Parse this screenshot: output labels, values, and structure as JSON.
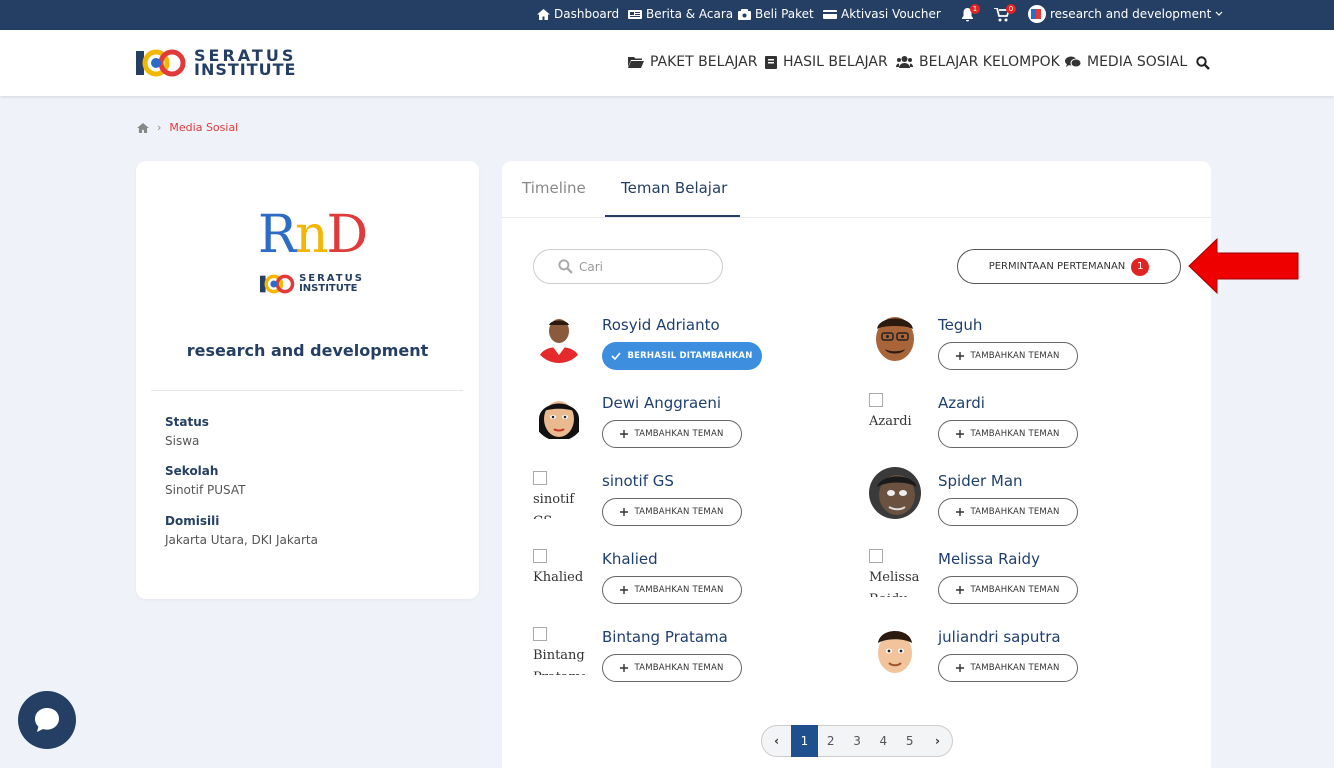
{
  "topbar": {
    "dashboard": "Dashboard",
    "berita": "Berita & Acara",
    "beli": "Beli Paket",
    "aktivasi": "Aktivasi Voucher",
    "notif_count": "1",
    "cart_count": "0",
    "user": "research and development"
  },
  "header": {
    "brand_line1": "SERATUS",
    "brand_line2": "INSTITUTE",
    "nav": {
      "paket": "PAKET BELAJAR",
      "hasil": "HASIL BELAJAR",
      "kelompok": "BELAJAR KELOMPOK",
      "media": "MEDIA SOSIAL"
    }
  },
  "breadcrumb": {
    "current": "Media Sosial"
  },
  "profile": {
    "logo_text": "RnD",
    "logo_sub1": "SERATUS",
    "logo_sub2": "INSTITUTE",
    "name": "research and development",
    "status_label": "Status",
    "status_value": "Siswa",
    "school_label": "Sekolah",
    "school_value": "Sinotif PUSAT",
    "domicile_label": "Domisili",
    "domicile_value": "Jakarta Utara, DKI Jakarta"
  },
  "tabs": {
    "timeline": "Timeline",
    "friends": "Teman Belajar"
  },
  "search": {
    "placeholder": "Cari"
  },
  "requests": {
    "label": "PERMINTAAN PERTEMANAN",
    "count": "1"
  },
  "buttons": {
    "add": "TAMBAHKAN TEMAN",
    "added": "BERHASIL DITAMBAHKAN"
  },
  "friends": [
    {
      "name": "Rosyid Adrianto",
      "alt": ""
    },
    {
      "name": "Teguh",
      "alt": ""
    },
    {
      "name": "Dewi Anggraeni",
      "alt": ""
    },
    {
      "name": "Azardi",
      "alt": "Azardi"
    },
    {
      "name": "sinotif GS",
      "alt": "sinotif GS"
    },
    {
      "name": "Spider Man",
      "alt": ""
    },
    {
      "name": "Khalied",
      "alt": "Khalied"
    },
    {
      "name": "Melissa Raidy",
      "alt": "Melissa Raidy"
    },
    {
      "name": "Bintang Pratama",
      "alt": "Bintang Pratama"
    },
    {
      "name": "juliandri saputra",
      "alt": ""
    }
  ],
  "pagination": {
    "pages": [
      "1",
      "2",
      "3",
      "4",
      "5"
    ],
    "prev": "‹",
    "next": "›"
  },
  "colors": {
    "navy": "#243f63",
    "accent_red": "#e02424",
    "added_blue": "#3e8ee0"
  }
}
